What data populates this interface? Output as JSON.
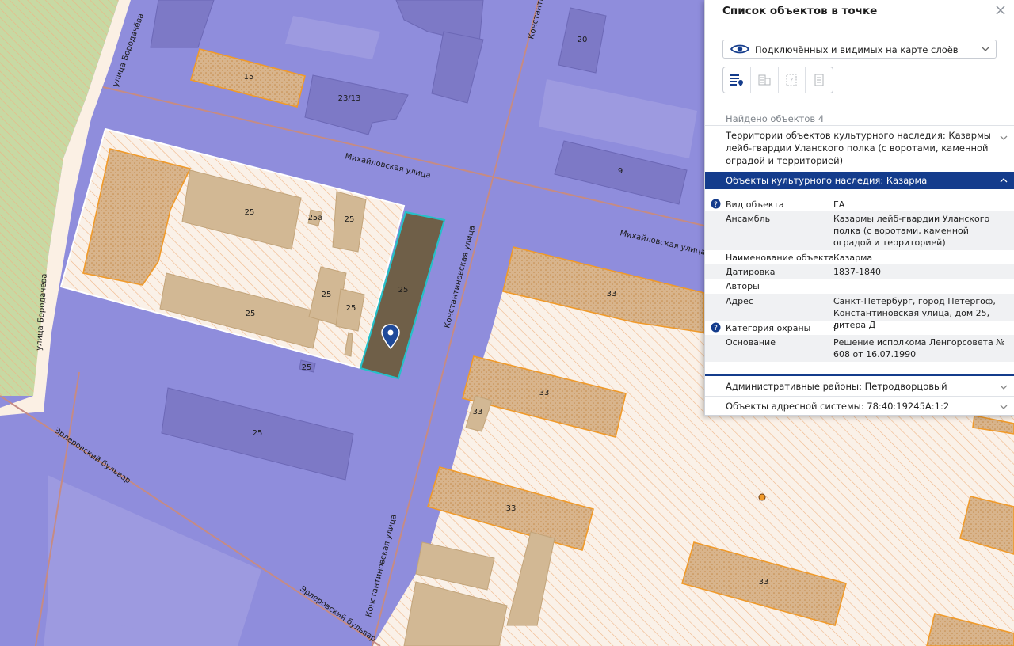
{
  "map": {
    "street_labels": [
      "Михайловская улица",
      "Михайловская улица",
      "Константиновская улица",
      "Константиновская улица",
      "Константиновская улица",
      "улица Бородачёва",
      "улица Бородачёва",
      "Эрлеровский бульвар",
      "Эрлеровский бульвар"
    ],
    "building_numbers": [
      "15",
      "23/13",
      "20",
      "9",
      "25",
      "25а",
      "25",
      "25",
      "25",
      "25",
      "25",
      "25",
      "25",
      "33",
      "33",
      "33",
      "33",
      "33"
    ],
    "colors": {
      "street_area": "#8f8ddc",
      "building": "#d2b894",
      "selected": "#6f5f48",
      "selected_outline": "#25c0c8",
      "heritage_outline": "#f09a2a"
    }
  },
  "panel": {
    "title": "Список объектов в точке",
    "close_icon": "close-icon",
    "layer_select": {
      "value": "Подключённых и видимых на карте слоёв"
    },
    "found_text": "Найдено объектов 4",
    "sections": [
      {
        "label": "Территории объектов культурного наследия: Казармы лейб-гвардии Уланского полка (с воротами, каменной оградой и территорией)",
        "expanded": false
      },
      {
        "label": "Объекты культурного наследия: Казарма",
        "expanded": true
      },
      {
        "label": "Административные районы: Петродворцовый",
        "expanded": false
      },
      {
        "label": "Объекты адресной системы: 78:40:19245А:1:2",
        "expanded": false
      }
    ],
    "attributes": [
      {
        "key": "Вид объекта",
        "value": "ГА",
        "help": true
      },
      {
        "key": "Ансамбль",
        "value": "Казармы лейб-гвардии Уланского полка (с воротами, каменной оградой и территорией)",
        "help": false
      },
      {
        "key": "Наименование объекта",
        "value": "Казарма",
        "help": false
      },
      {
        "key": "Датировка",
        "value": "1837-1840",
        "help": false
      },
      {
        "key": "Авторы",
        "value": "",
        "help": false
      },
      {
        "key": "Адрес",
        "value": "Санкт-Петербург, город Петергоф, Константиновская улица, дом 25, литера Д",
        "help": false
      },
      {
        "key": "Категория охраны",
        "value": "Р",
        "help": true
      },
      {
        "key": "Основание",
        "value": "Решение исполкома Ленгорсовета № 608 от 16.07.1990",
        "help": false
      }
    ]
  }
}
